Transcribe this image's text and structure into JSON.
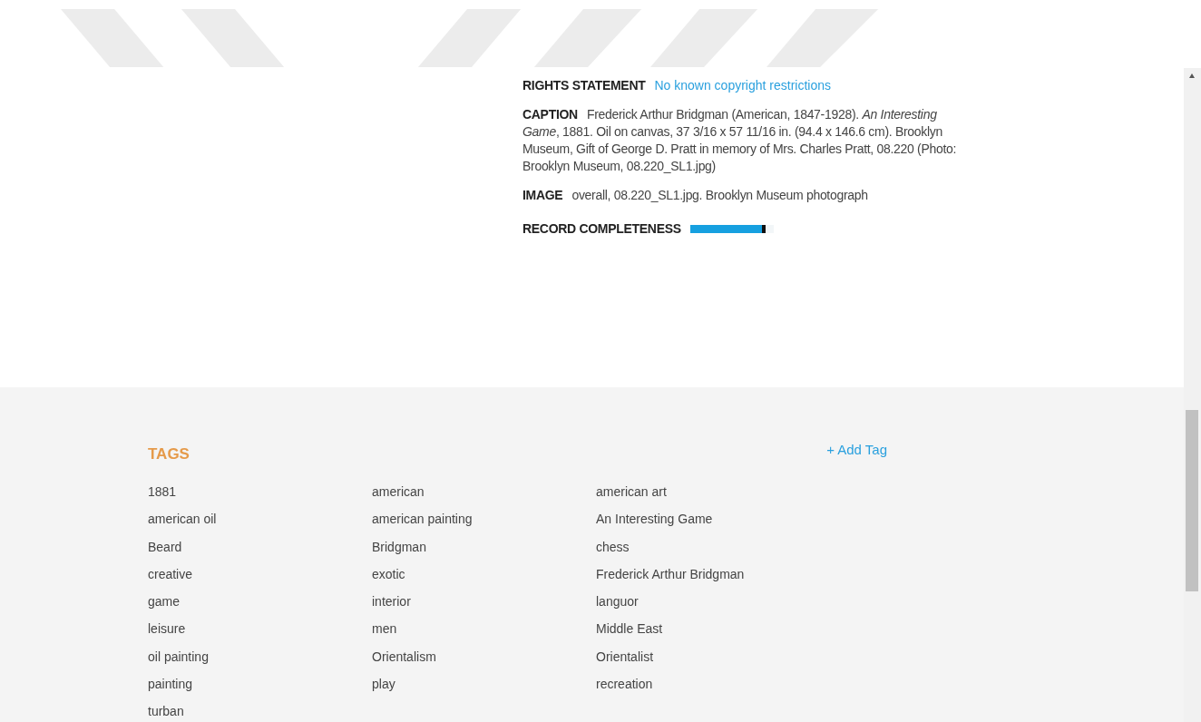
{
  "details": [
    {
      "kind": "link",
      "label": "RIGHTS STATEMENT",
      "value": "No known copyright restrictions"
    },
    {
      "kind": "text",
      "label": "CAPTION",
      "value": "Frederick Arthur Bridgman (American, 1847-1928). *An Interesting Game*, 1881. Oil on canvas, 37 3/16 x 57 11/16 in. (94.4 x 146.6 cm). Brooklyn Museum, Gift of George D. Pratt in memory of Mrs. Charles Pratt, 08.220 (Photo: Brooklyn Museum, 08.220_SL1.jpg)"
    },
    {
      "kind": "text",
      "label": "IMAGE",
      "value": "overall, 08.220_SL1.jpg. Brooklyn Museum photograph"
    },
    {
      "kind": "meter",
      "label": "RECORD COMPLETENESS",
      "level": 0.9
    }
  ],
  "tags": {
    "title": "TAGS",
    "add_button": "+ Add Tag",
    "items": [
      "1881",
      "american",
      "american art",
      "american oil",
      "american painting",
      "An Interesting Game",
      "Beard",
      "Bridgman",
      "chess",
      "creative",
      "exotic",
      "Frederick Arthur Bridgman",
      "game",
      "interior",
      "languor",
      "leisure",
      "men",
      "Middle East",
      "oil painting",
      "Orientalism",
      "Orientalist",
      "painting",
      "play",
      "recreation",
      "turban"
    ]
  }
}
